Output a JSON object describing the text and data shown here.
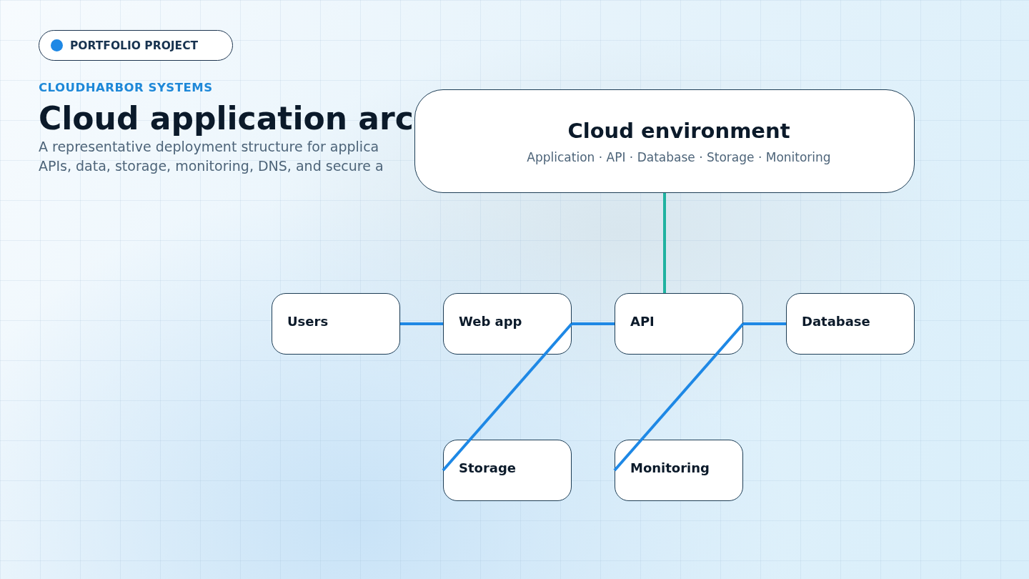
{
  "badge": {
    "label": "PORTFOLIO PROJECT",
    "color": "#1e88e5"
  },
  "kicker": "CLOUDHARBOR SYSTEMS",
  "title": "Cloud application arc",
  "subtitle_lines": [
    "A representative deployment structure for applica",
    "APIs, data, storage, monitoring, DNS, and secure a"
  ],
  "cloud": {
    "title": "Cloud environment",
    "subtitle": "Application · API · Database · Storage · Monitoring"
  },
  "nodes": [
    {
      "label": "Users"
    },
    {
      "label": "Web app"
    },
    {
      "label": "API"
    },
    {
      "label": "Database"
    },
    {
      "label": "Storage"
    },
    {
      "label": "Monitoring"
    }
  ],
  "connectors": [
    {
      "color": "#20b2a0"
    },
    {
      "color": "#1e88e5"
    },
    {
      "color": "#1e88e5"
    },
    {
      "color": "#1e88e5"
    },
    {
      "color": "#1e88e5"
    },
    {
      "color": "#1e88e5"
    }
  ]
}
